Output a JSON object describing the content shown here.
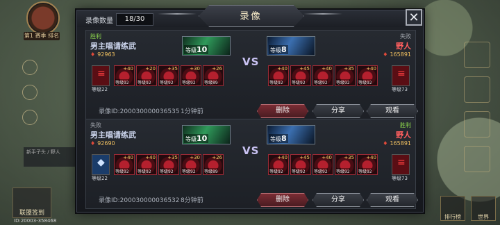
{
  "background": {
    "badge": "第1 赛季 排名",
    "id_label": "ID:20003-358468",
    "chat_line": "新手子头 / 野人",
    "bottom_left_label": "联盟签到",
    "bottom_right_labels": [
      "排行榜",
      "世界"
    ]
  },
  "header": {
    "count_label": "录像数量",
    "count_value": "18/30",
    "title": "录像",
    "close_icon": "close-x-icon"
  },
  "records": [
    {
      "left": {
        "result": "胜利",
        "name": "男主唱请练武",
        "power": "92963",
        "boss_level_label": "等级",
        "boss_level": "10",
        "lead_level": "等级22"
      },
      "right": {
        "result": "失败",
        "name": "野人",
        "power": "165891",
        "boss_level_label": "等级",
        "boss_level": "8",
        "lead_level": "等级73"
      },
      "vs": "VS",
      "left_units": [
        {
          "stars": "+40",
          "level": "等级92"
        },
        {
          "stars": "+20",
          "level": "等级92"
        },
        {
          "stars": "+35",
          "level": "等级92"
        },
        {
          "stars": "+30",
          "level": "等级92"
        },
        {
          "stars": "+26",
          "level": "等级89"
        }
      ],
      "right_units": [
        {
          "stars": "+40",
          "level": "等级92"
        },
        {
          "stars": "+45",
          "level": "等级92"
        },
        {
          "stars": "+40",
          "level": "等级92"
        },
        {
          "stars": "+35",
          "level": "等级92"
        },
        {
          "stars": "+40",
          "level": "等级92"
        }
      ],
      "record_id": "录像ID:200030000036535",
      "time_ago": "1分钟前",
      "delete_label": "删除",
      "share_label": "分享",
      "view_label": "观看"
    },
    {
      "left": {
        "result": "失败",
        "name": "男主唱请练武",
        "power": "92690",
        "boss_level_label": "等级",
        "boss_level": "10",
        "lead_level": "等级22"
      },
      "right": {
        "result": "胜利",
        "name": "野人",
        "power": "165891",
        "boss_level_label": "等级",
        "boss_level": "8",
        "lead_level": "等级73"
      },
      "vs": "VS",
      "left_units": [
        {
          "stars": "+40",
          "level": "等级92"
        },
        {
          "stars": "+40",
          "level": "等级92"
        },
        {
          "stars": "+35",
          "level": "等级92"
        },
        {
          "stars": "+30",
          "level": "等级92"
        },
        {
          "stars": "+26",
          "level": "等级89"
        }
      ],
      "right_units": [
        {
          "stars": "+40",
          "level": "等级92"
        },
        {
          "stars": "+45",
          "level": "等级92"
        },
        {
          "stars": "+40",
          "level": "等级92"
        },
        {
          "stars": "+35",
          "level": "等级92"
        },
        {
          "stars": "+40",
          "level": "等级92"
        }
      ],
      "record_id": "录像ID:200030000036532",
      "time_ago": "8分钟前",
      "delete_label": "删除",
      "share_label": "分享",
      "view_label": "观看"
    }
  ]
}
